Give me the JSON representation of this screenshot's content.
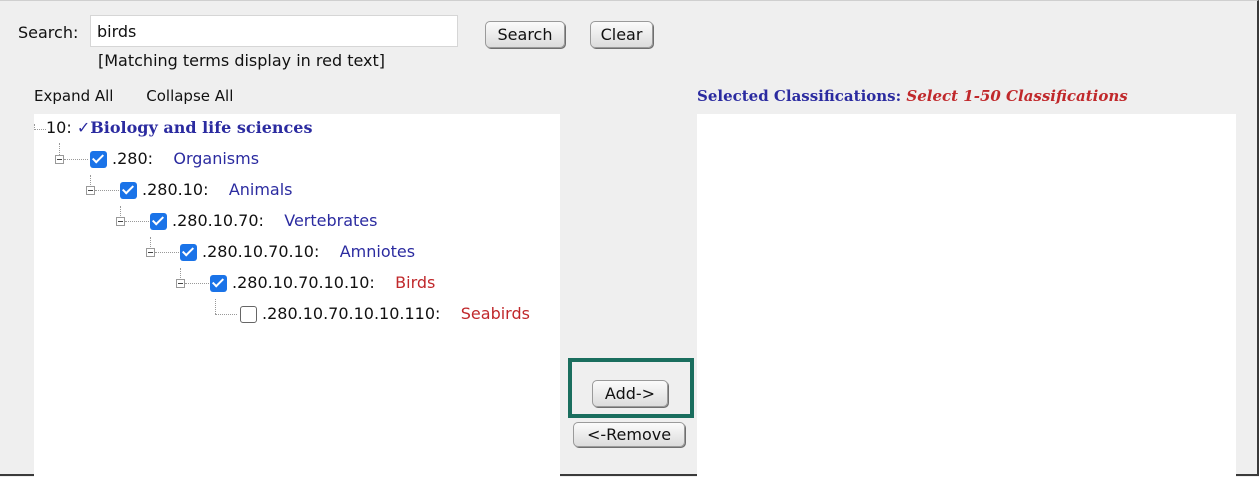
{
  "search": {
    "label": "Search:",
    "value": "birds",
    "hint": "[Matching terms display in red text]",
    "search_button": "Search",
    "clear_button": "Clear"
  },
  "toolbar": {
    "expand_all": "Expand All",
    "collapse_all": "Collapse All"
  },
  "tree": {
    "root": {
      "code": "10:",
      "check": "✓",
      "term": "Biology and life sciences"
    },
    "nodes": [
      {
        "code": ".280:",
        "term": "Organisms",
        "checked": true,
        "match": false
      },
      {
        "code": ".280.10:",
        "term": "Animals",
        "checked": true,
        "match": false
      },
      {
        "code": ".280.10.70:",
        "term": "Vertebrates",
        "checked": true,
        "match": false
      },
      {
        "code": ".280.10.70.10:",
        "term": "Amniotes",
        "checked": true,
        "match": false
      },
      {
        "code": ".280.10.70.10.10:",
        "term": "Birds",
        "checked": true,
        "match": true
      },
      {
        "code": ".280.10.70.10.10.110:",
        "term": "Seabirds",
        "checked": false,
        "match": true
      }
    ]
  },
  "actions": {
    "add": "Add->",
    "remove": "<-Remove"
  },
  "selected": {
    "title": "Selected Classifications:",
    "hint": "Select 1-50 Classifications"
  },
  "colors": {
    "term_blue": "#2b2ba0",
    "match_red": "#c0282b",
    "checkbox_blue": "#1a73e8",
    "highlight_green": "#1a6e5e"
  }
}
